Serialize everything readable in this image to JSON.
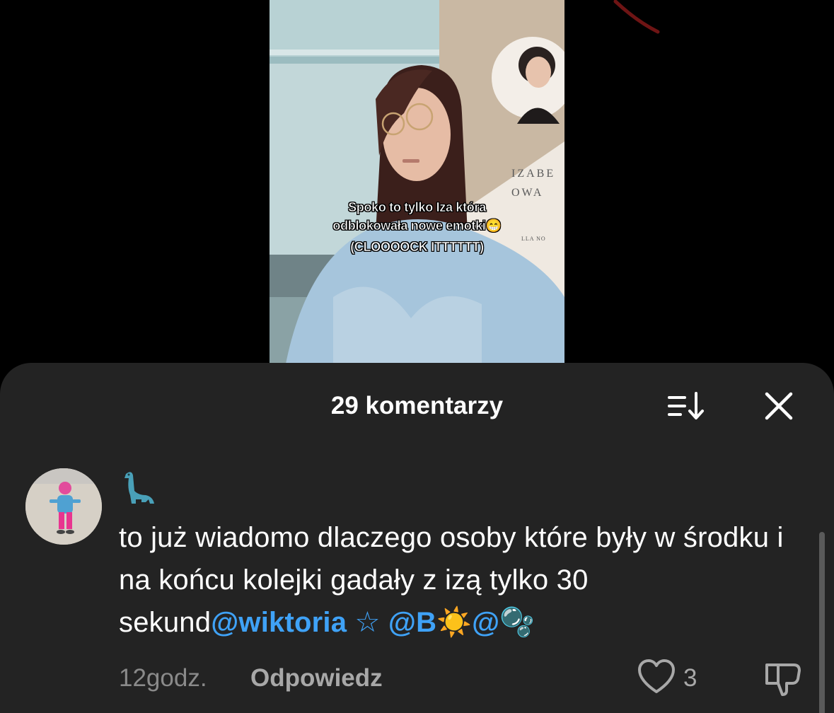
{
  "video": {
    "caption_line1": "Spoko to tylko Iza która",
    "caption_line2": "odblokowała nowe emotki😁",
    "caption_line3": "(CLOOOOCK ITTTTTT)",
    "banner_text_top": "IZABE",
    "banner_text_bottom": "OWA",
    "banner_small_text": "LLA NO"
  },
  "comments_sheet": {
    "title": "29 komentarzy",
    "sort_icon": "sort-icon",
    "close_icon": "close-icon"
  },
  "comment": {
    "avatar_icon": "avatar",
    "username_emoji": "🦕",
    "text_plain": "to już wiadomo dlaczego osoby które były w środku i na końcu kolejki gadały z izą tylko 30 sekund",
    "mention1": "@wiktoria ☆",
    "mention2": "@B☀️",
    "mention3": "@🫧",
    "timestamp": "12godz.",
    "reply_label": "Odpowiedz",
    "like_count": "3",
    "like_icon": "heart-icon",
    "dislike_icon": "thumbs-down-icon"
  },
  "colors": {
    "sheet_background": "#232323",
    "mention": "#3fa2f7",
    "muted_text": "#8a8a8a"
  }
}
